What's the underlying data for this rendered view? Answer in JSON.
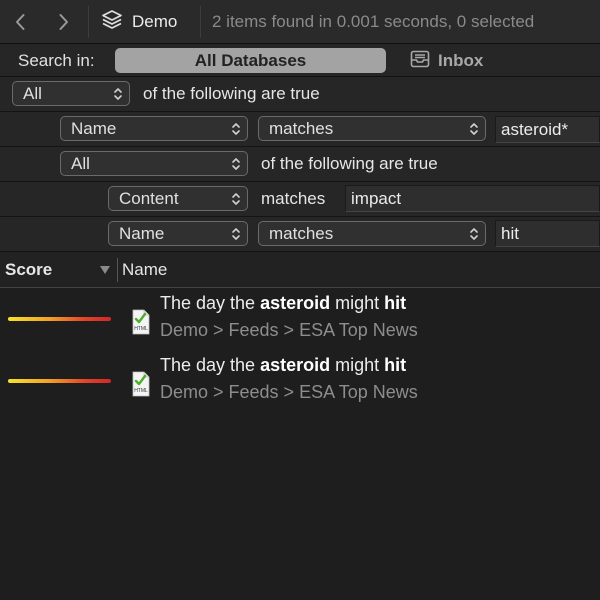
{
  "toolbar": {
    "database_name": "Demo",
    "status": "2 items found in 0.001 seconds, 0 selected"
  },
  "scope": {
    "label": "Search in:",
    "all_databases": "All Databases",
    "inbox": "Inbox"
  },
  "criteria": {
    "root": {
      "quantifier": "All",
      "text": "of the following are true"
    },
    "name_asteroid": {
      "field": "Name",
      "operator": "matches",
      "value": "asteroid*"
    },
    "group": {
      "quantifier": "All",
      "text": "of the following are true"
    },
    "content_impact": {
      "field": "Content",
      "operator": "matches",
      "value": "impact"
    },
    "name_hit": {
      "field": "Name",
      "operator": "matches",
      "value": "hit"
    }
  },
  "columns": {
    "score": "Score",
    "name": "Name"
  },
  "results": [
    {
      "title_pre": "The day the ",
      "title_b1": "asteroid",
      "title_mid": " might ",
      "title_b2": "hit",
      "path": "Demo > Feeds > ESA Top News",
      "icon_label": "HTML"
    },
    {
      "title_pre": "The day the ",
      "title_b1": "asteroid",
      "title_mid": " might ",
      "title_b2": "hit",
      "path": "Demo > Feeds > ESA Top News",
      "icon_label": "HTML"
    }
  ],
  "colors": {
    "background": "#1e1e1e",
    "scope_selected": "#a3a3a3",
    "score_gradient": [
      "#f6e32a",
      "#f3a125",
      "#e2432a",
      "#d02828"
    ],
    "doc_icon_accent": "#4caf2a"
  },
  "icons": {
    "back": "chevron-left-icon",
    "forward": "chevron-right-icon",
    "database": "database-stack-icon",
    "inbox": "inbox-tray-icon",
    "sort": "sort-descending-icon",
    "popup": "chevron-updown-icon",
    "document": "html-document-icon"
  }
}
